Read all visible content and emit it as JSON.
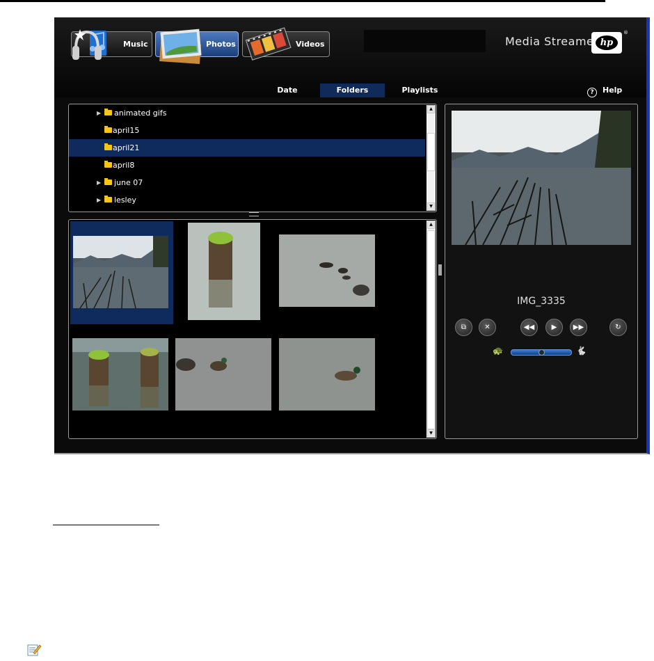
{
  "media_tabs": [
    {
      "label": "Music",
      "icon": "headphones-icon",
      "active": false
    },
    {
      "label": "Photos",
      "icon": "photos-icon",
      "active": true
    },
    {
      "label": "Videos",
      "icon": "film-icon",
      "active": false
    }
  ],
  "brand": {
    "name": "Media Streamer",
    "logo_text": "hp",
    "registered": "®"
  },
  "view_tabs": [
    {
      "label": "Date",
      "active": false
    },
    {
      "label": "Folders",
      "active": true
    },
    {
      "label": "Playlists",
      "active": false
    }
  ],
  "help_label": "Help",
  "folders": [
    {
      "name": "animated gifs",
      "expandable": true,
      "selected": false
    },
    {
      "name": "april15",
      "expandable": false,
      "selected": false
    },
    {
      "name": "april21",
      "expandable": false,
      "selected": true
    },
    {
      "name": "april8",
      "expandable": false,
      "selected": false
    },
    {
      "name": "june 07",
      "expandable": true,
      "selected": false
    },
    {
      "name": "lesley",
      "expandable": true,
      "selected": false
    }
  ],
  "preview": {
    "caption": "IMG_3335"
  },
  "controls": [
    {
      "icon": "slideshow-icon"
    },
    {
      "icon": "fullscreen-icon"
    },
    {
      "icon": "rewind-icon"
    },
    {
      "icon": "play-icon"
    },
    {
      "icon": "fast-forward-icon"
    },
    {
      "icon": "rotate-icon"
    }
  ],
  "speed": {
    "slow_icon": "turtle-icon",
    "fast_icon": "rabbit-icon",
    "level": 0.5
  },
  "colors": {
    "accent": "#1737b8",
    "selection": "#0f2b5e",
    "folder": "#f5c518"
  }
}
